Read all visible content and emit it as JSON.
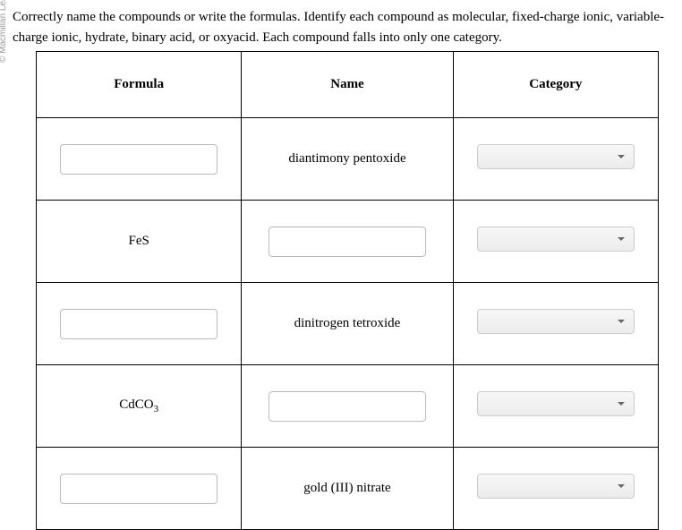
{
  "watermark": "© Macmillan Learning",
  "instructions": "Correctly name the compounds or write the formulas. Identify each compound as molecular, fixed-charge ionic, variable-charge ionic, hydrate, binary acid, or oxyacid. Each compound falls into only one category.",
  "headers": {
    "formula": "Formula",
    "name": "Name",
    "category": "Category"
  },
  "rows": [
    {
      "formula": "",
      "formula_input": true,
      "name": "diantimony pentoxide",
      "name_input": false
    },
    {
      "formula": "FeS",
      "formula_input": false,
      "name": "",
      "name_input": true
    },
    {
      "formula": "",
      "formula_input": true,
      "name": "dinitrogen tetroxide",
      "name_input": false
    },
    {
      "formula_html": "CdCO<sub>3</sub>",
      "formula_input": false,
      "name": "",
      "name_input": true
    },
    {
      "formula": "",
      "formula_input": true,
      "name": "gold (III) nitrate",
      "name_input": false
    }
  ]
}
